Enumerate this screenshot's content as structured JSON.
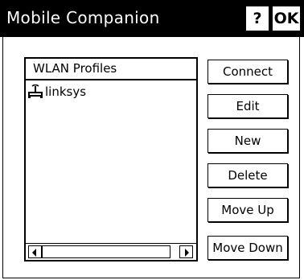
{
  "window": {
    "title": "Mobile Companion",
    "help_label": "?",
    "ok_label": "OK"
  },
  "list": {
    "header": "WLAN Profiles",
    "items": [
      {
        "label": "linksys",
        "icon": "network-adapter-icon"
      }
    ]
  },
  "buttons": {
    "connect": "Connect",
    "edit": "Edit",
    "new": "New",
    "delete": "Delete",
    "move_up": "Move Up",
    "move_down": "Move Down"
  }
}
